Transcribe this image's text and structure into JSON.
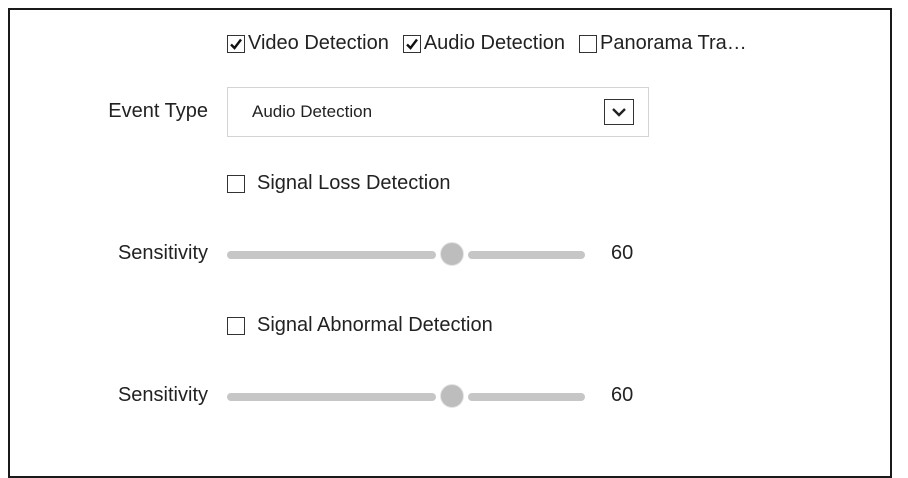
{
  "event_types": {
    "video_detection": {
      "label": "Video Detection",
      "checked": true
    },
    "audio_detection": {
      "label": "Audio Detection",
      "checked": true
    },
    "panorama": {
      "label": "Panorama Tra…",
      "checked": false
    }
  },
  "event_type_field": {
    "label": "Event Type",
    "selected": "Audio Detection",
    "arrow_icon": "chevron-down-icon"
  },
  "signal_loss": {
    "label": "Signal Loss Detection",
    "checked": false
  },
  "sensitivity_1": {
    "label": "Sensitivity",
    "value": "60",
    "fraction": 0.6
  },
  "signal_abnormal": {
    "label": "Signal Abnormal Detection",
    "checked": false
  },
  "sensitivity_2": {
    "label": "Sensitivity",
    "value": "60",
    "fraction": 0.6
  }
}
